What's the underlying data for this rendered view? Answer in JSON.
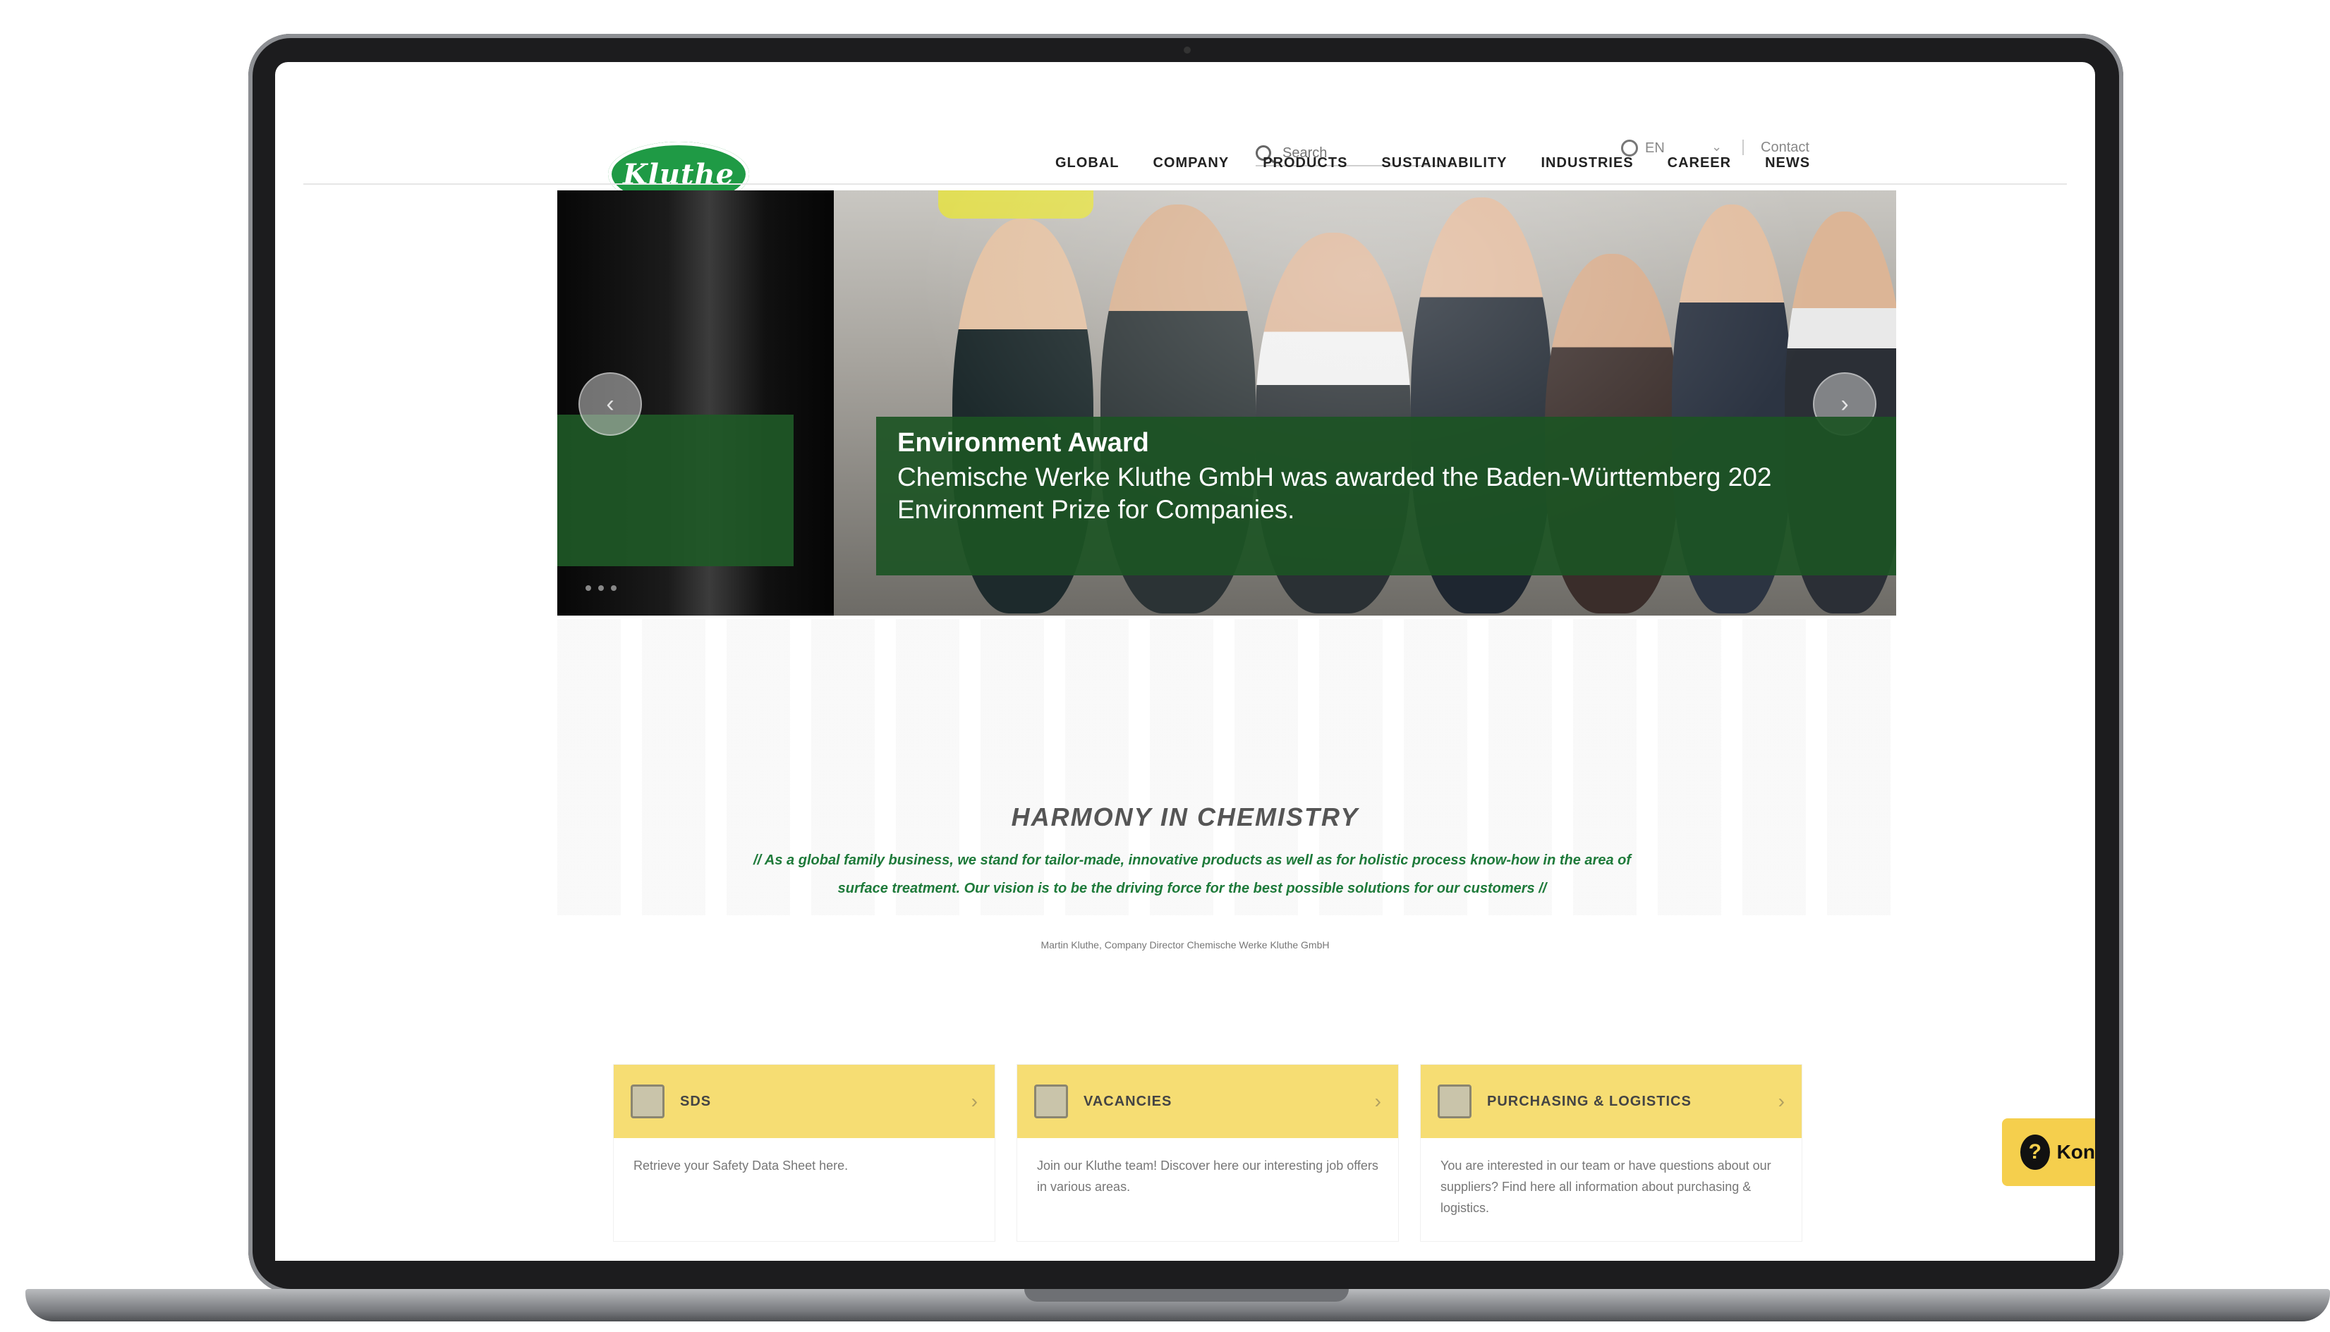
{
  "header": {
    "logo_text": "Kluthe",
    "search_placeholder": "Search",
    "language": "EN",
    "contact_label": "Contact"
  },
  "nav": {
    "items": [
      {
        "label": "GLOBAL"
      },
      {
        "label": "COMPANY"
      },
      {
        "label": "PRODUCTS"
      },
      {
        "label": "SUSTAINABILITY"
      },
      {
        "label": "INDUSTRIES"
      },
      {
        "label": "CAREER"
      },
      {
        "label": "NEWS"
      }
    ]
  },
  "hero": {
    "title": "Environment Award",
    "line1": "Chemische Werke Kluthe GmbH was awarded the Baden-Württemberg 202",
    "line2": "Environment Prize for Companies."
  },
  "harmony": {
    "title": "HARMONY IN CHEMISTRY",
    "quote": "// As a global family business, we stand for tailor-made, innovative products as well as for holistic process know-how in the area of surface treatment. Our vision is to be the driving force for the best possible solutions for our customers //",
    "author": "Martin Kluthe, Company Director Chemische Werke Kluthe GmbH"
  },
  "cards": [
    {
      "label": "SDS",
      "description": "Retrieve your Safety Data Sheet here."
    },
    {
      "label": "VACANCIES",
      "description": "Join our Kluthe team! Discover here our interesting job offers in various areas."
    },
    {
      "label": "PURCHASING & LOGISTICS",
      "description": "You are interested in our team or have questions about our suppliers? Find here all information about purchasing & logistics."
    }
  ],
  "help": {
    "icon": "question-icon",
    "label": "Kon"
  },
  "colors": {
    "brand_green": "#1f9a45",
    "caption_green": "#1c5424",
    "card_yellow": "#f6dd73",
    "help_yellow": "#f5cf4d"
  }
}
